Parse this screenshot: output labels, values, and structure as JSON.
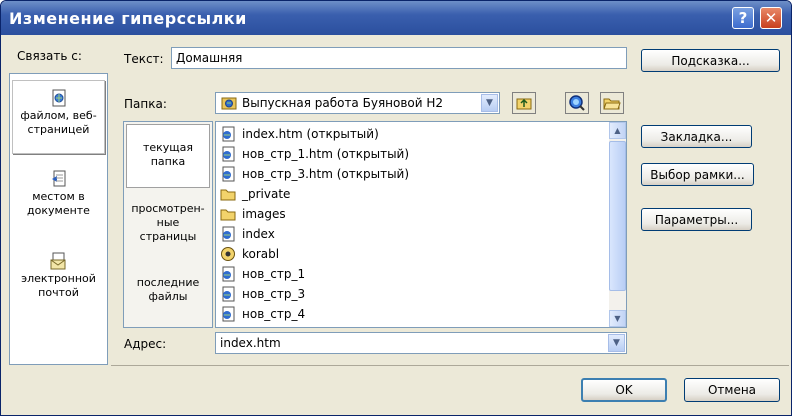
{
  "window": {
    "title": "Изменение гиперссылки"
  },
  "titlebar": {
    "help": "?",
    "close": "✕"
  },
  "link_to": {
    "label": "Связать с:",
    "items": [
      {
        "label_line1": "файлом, веб-",
        "label_line2": "страницей",
        "icon": "globe-page-icon"
      },
      {
        "label_line1": "местом в",
        "label_line2": "документе",
        "icon": "document-place-icon"
      },
      {
        "label_line1": "электронной",
        "label_line2": "почтой",
        "icon": "email-icon"
      }
    ]
  },
  "text_field": {
    "label": "Текст:",
    "value": "Домашняя"
  },
  "tooltip_button": "Подсказка...",
  "folder": {
    "label": "Папка:",
    "value": "Выпускная работа Буяновой Н2"
  },
  "sources": [
    {
      "line1": "текущая",
      "line2": "папка"
    },
    {
      "line1": "просмотрен-",
      "line2": "ные",
      "line3": "страницы"
    },
    {
      "line1": "последние",
      "line2": "файлы"
    }
  ],
  "files": [
    {
      "name": "index.htm (открытый)",
      "icon": "html-file-icon"
    },
    {
      "name": "нов_стр_1.htm (открытый)",
      "icon": "html-file-icon"
    },
    {
      "name": "нов_стр_3.htm (открытый)",
      "icon": "html-file-icon"
    },
    {
      "name": "_private",
      "icon": "folder-icon"
    },
    {
      "name": "images",
      "icon": "folder-icon"
    },
    {
      "name": "index",
      "icon": "html-file-icon"
    },
    {
      "name": "korabl",
      "icon": "media-file-icon"
    },
    {
      "name": "нов_стр_1",
      "icon": "html-file-icon"
    },
    {
      "name": "нов_стр_3",
      "icon": "html-file-icon"
    },
    {
      "name": "нов_стр_4",
      "icon": "html-file-icon"
    }
  ],
  "side_buttons": {
    "bookmark": "Закладка...",
    "frame": "Выбор рамки...",
    "params": "Параметры..."
  },
  "address": {
    "label": "Адрес:",
    "value": "index.htm"
  },
  "footer": {
    "ok": "OK",
    "cancel": "Отмена"
  }
}
